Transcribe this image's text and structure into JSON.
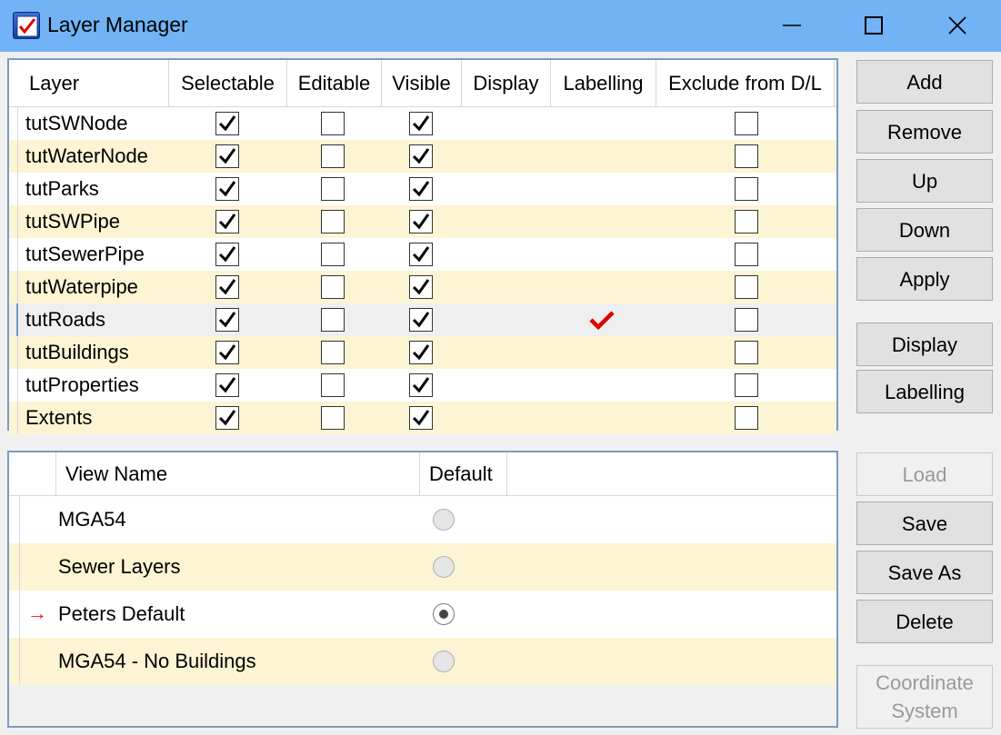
{
  "window": {
    "title": "Layer Manager",
    "icon": "layer-manager-checkmark-icon"
  },
  "layers_table": {
    "columns": [
      "Layer",
      "Selectable",
      "Editable",
      "Visible",
      "Display",
      "Labelling",
      "Exclude from D/L"
    ],
    "rows": [
      {
        "name": "tutSWNode",
        "selectable": true,
        "editable": false,
        "visible": true,
        "labelling": false,
        "exclude": false
      },
      {
        "name": "tutWaterNode",
        "selectable": true,
        "editable": false,
        "visible": true,
        "labelling": false,
        "exclude": false
      },
      {
        "name": "tutParks",
        "selectable": true,
        "editable": false,
        "visible": true,
        "labelling": false,
        "exclude": false
      },
      {
        "name": "tutSWPipe",
        "selectable": true,
        "editable": false,
        "visible": true,
        "labelling": false,
        "exclude": false
      },
      {
        "name": "tutSewerPipe",
        "selectable": true,
        "editable": false,
        "visible": true,
        "labelling": false,
        "exclude": false
      },
      {
        "name": "tutWaterpipe",
        "selectable": true,
        "editable": false,
        "visible": true,
        "labelling": false,
        "exclude": false
      },
      {
        "name": "tutRoads",
        "selectable": true,
        "editable": false,
        "visible": true,
        "labelling": true,
        "exclude": false
      },
      {
        "name": "tutBuildings",
        "selectable": true,
        "editable": false,
        "visible": true,
        "labelling": false,
        "exclude": false
      },
      {
        "name": "tutProperties",
        "selectable": true,
        "editable": false,
        "visible": true,
        "labelling": false,
        "exclude": false
      },
      {
        "name": "Extents",
        "selectable": true,
        "editable": false,
        "visible": true,
        "labelling": false,
        "exclude": false
      }
    ],
    "selected_row": "tutRoads"
  },
  "views_table": {
    "columns": [
      "View Name",
      "Default"
    ],
    "rows": [
      {
        "name": "MGA54",
        "default": false,
        "current": false
      },
      {
        "name": "Sewer Layers",
        "default": false,
        "current": false
      },
      {
        "name": "Peters Default",
        "default": true,
        "current": true
      },
      {
        "name": "MGA54 - No Buildings",
        "default": false,
        "current": false
      }
    ],
    "current_marker": "→"
  },
  "layer_buttons": {
    "add": "Add",
    "remove": "Remove",
    "up": "Up",
    "down": "Down",
    "apply": "Apply",
    "display": "Display",
    "labelling": "Labelling"
  },
  "view_buttons": {
    "load": "Load",
    "save": "Save",
    "save_as": "Save As",
    "delete": "Delete",
    "coordinate_system": "Coordinate\nSystem"
  },
  "colors": {
    "titlebar": "#71b3f5",
    "alt_row": "#fdf4d4",
    "panel_border": "#7a9cc0",
    "label_check": "#e00000",
    "current_arrow": "#e02020"
  }
}
